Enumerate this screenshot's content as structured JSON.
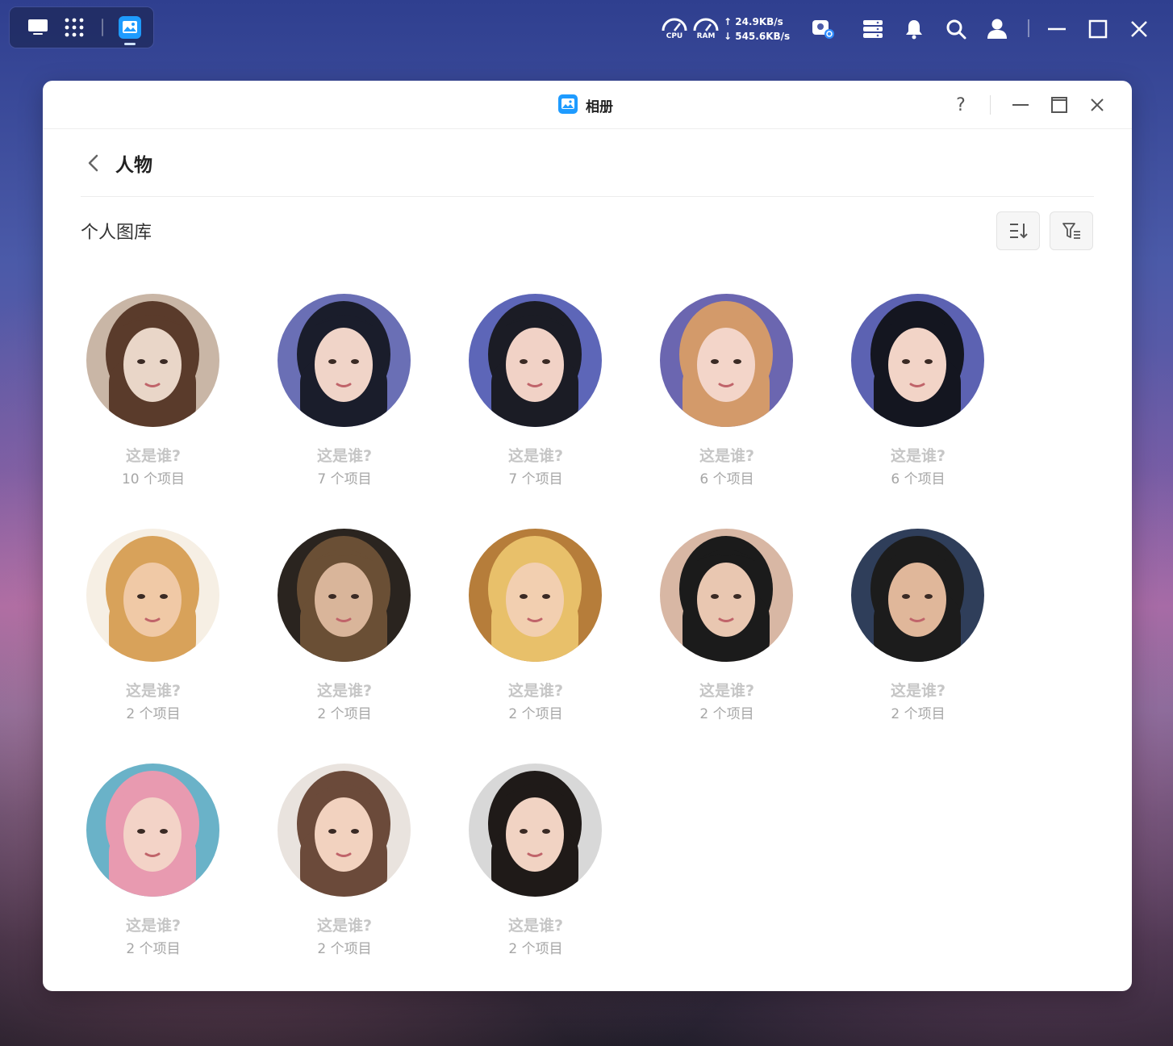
{
  "taskbar": {
    "desktop_icon": "desktop-icon",
    "apps_icon": "grid-apps-icon",
    "active_app_icon": "photos-app-icon"
  },
  "system": {
    "cpu_label": "CPU",
    "ram_label": "RAM",
    "upload_rate": "↑ 24.9KB/s",
    "download_rate": "↓ 545.6KB/s"
  },
  "window": {
    "title": "相册",
    "help_label": "?"
  },
  "page": {
    "title": "人物",
    "section_title": "个人图库"
  },
  "people": [
    {
      "name": "这是谁?",
      "count": "10 个项目",
      "colors": [
        "#e9d6c8",
        "#5a3b2b",
        "#c9b6a6"
      ]
    },
    {
      "name": "这是谁?",
      "count": "7 个项目",
      "colors": [
        "#f0d4c8",
        "#1a1d2b",
        "#6a6fb5"
      ]
    },
    {
      "name": "这是谁?",
      "count": "7 个项目",
      "colors": [
        "#f1d2c6",
        "#1b1c25",
        "#5d66b8"
      ]
    },
    {
      "name": "这是谁?",
      "count": "6 个项目",
      "colors": [
        "#f3d5c9",
        "#d39a6a",
        "#6b66b0"
      ]
    },
    {
      "name": "这是谁?",
      "count": "6 个项目",
      "colors": [
        "#f2d4c7",
        "#141620",
        "#5c62b2"
      ]
    },
    {
      "name": "这是谁?",
      "count": "2 个项目",
      "colors": [
        "#f0c9a6",
        "#d8a25a",
        "#f6efe4"
      ]
    },
    {
      "name": "这是谁?",
      "count": "2 个项目",
      "colors": [
        "#d9b59a",
        "#6a4f35",
        "#2a241f"
      ]
    },
    {
      "name": "这是谁?",
      "count": "2 个项目",
      "colors": [
        "#f2cfb0",
        "#e8c06a",
        "#b67d3a"
      ]
    },
    {
      "name": "这是谁?",
      "count": "2 个项目",
      "colors": [
        "#e9c7b1",
        "#1b1b1b",
        "#d8b7a4"
      ]
    },
    {
      "name": "这是谁?",
      "count": "2 个项目",
      "colors": [
        "#e0b79a",
        "#1c1c1c",
        "#2f3e5a"
      ]
    },
    {
      "name": "这是谁?",
      "count": "2 个项目",
      "colors": [
        "#f3d3c7",
        "#e89ab0",
        "#6ab2c8"
      ]
    },
    {
      "name": "这是谁?",
      "count": "2 个项目",
      "colors": [
        "#f2d2bf",
        "#6b4a3a",
        "#e9e3de"
      ]
    },
    {
      "name": "这是谁?",
      "count": "2 个项目",
      "colors": [
        "#f1d3c3",
        "#1f1a18",
        "#d8d8d8"
      ]
    }
  ]
}
